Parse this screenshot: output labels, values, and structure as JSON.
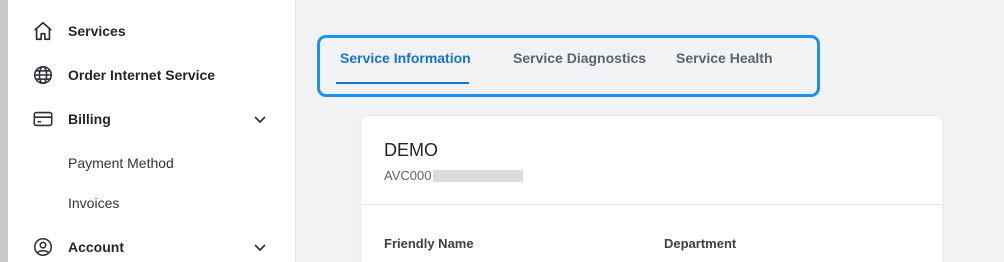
{
  "sidebar": {
    "items": [
      {
        "label": "Services",
        "icon": "home-icon"
      },
      {
        "label": "Order Internet Service",
        "icon": "globe-icon"
      },
      {
        "label": "Billing",
        "icon": "credit-card-icon",
        "expanded": true,
        "children": [
          {
            "label": "Payment Method"
          },
          {
            "label": "Invoices"
          }
        ]
      },
      {
        "label": "Account",
        "icon": "user-circle-icon",
        "expanded": false
      }
    ]
  },
  "tabs": {
    "items": [
      {
        "label": "Service Information",
        "active": true
      },
      {
        "label": "Service Diagnostics",
        "active": false
      },
      {
        "label": "Service Health",
        "active": false
      }
    ],
    "highlight_color": "#1e90e8",
    "active_color": "#1b72c9"
  },
  "card": {
    "title": "DEMO",
    "service_id_prefix": "AVC000",
    "fields": [
      {
        "label": "Friendly Name"
      },
      {
        "label": "Department"
      }
    ]
  }
}
